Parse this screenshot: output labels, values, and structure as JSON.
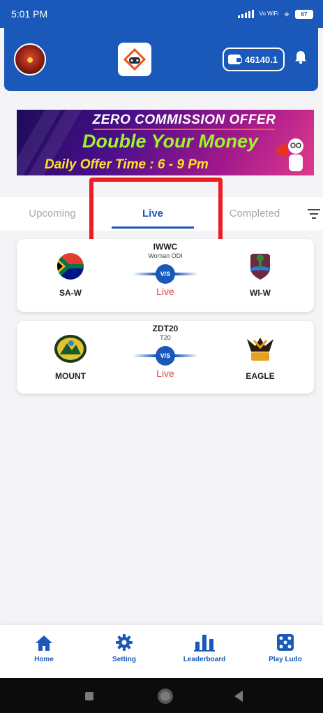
{
  "status_bar": {
    "time": "5:01 PM",
    "network_label": "Vo WiFi",
    "battery": "67"
  },
  "header": {
    "avatar": "user-avatar",
    "logo": "app-logo-icon",
    "wallet_balance": "46140.1",
    "bell": "bell-icon"
  },
  "banner": {
    "title": "ZERO COMMISSION OFFER",
    "headline": "Double Your Money",
    "subtitle": "Daily Offer Time : 6 - 9 Pm"
  },
  "tabs": {
    "items": [
      {
        "label": "Upcoming"
      },
      {
        "label": "Live"
      },
      {
        "label": "Completed"
      }
    ],
    "active": "Live"
  },
  "matches": [
    {
      "title": "IWWC",
      "format": "Woman ODI",
      "team_left": "SA-W",
      "team_right": "WI-W",
      "vs": "V/S",
      "status": "Live"
    },
    {
      "title": "ZDT20",
      "format": "T20",
      "team_left": "MOUNT",
      "team_right": "EAGLE",
      "vs": "V/S",
      "status": "Live"
    }
  ],
  "bottom_nav": {
    "items": [
      {
        "label": "Home",
        "icon": "home-icon"
      },
      {
        "label": "Setting",
        "icon": "gear-icon"
      },
      {
        "label": "Leaderboard",
        "icon": "leaderboard-icon"
      },
      {
        "label": "Play Ludo",
        "icon": "dice-icon"
      }
    ]
  },
  "colors": {
    "primary": "#1a58b9",
    "live_status": "#d94848",
    "highlight": "#ee1c24"
  }
}
